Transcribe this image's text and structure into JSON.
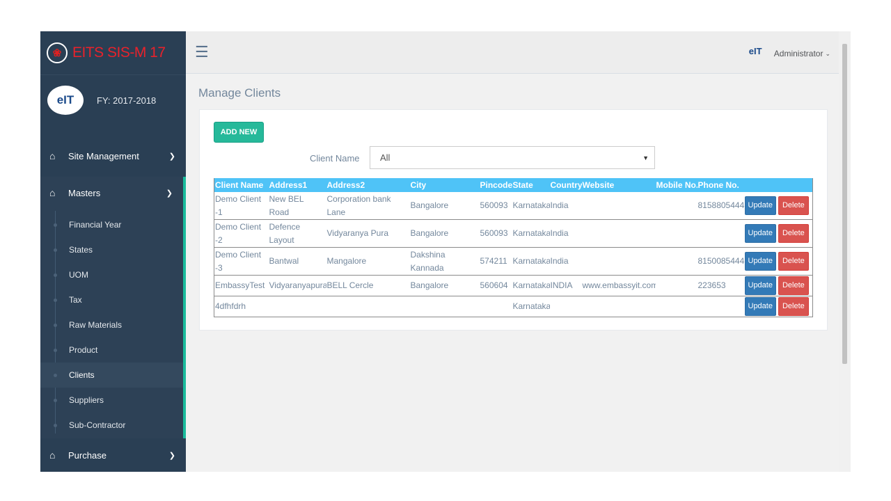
{
  "brand": {
    "logo_glyph": "❀",
    "title": "EITS SIS-M 17"
  },
  "profile": {
    "avatar_text": "eIT",
    "fy": "FY: 2017-2018"
  },
  "nav": {
    "site_management": "Site Management",
    "masters": "Masters",
    "purchase": "Purchase",
    "masters_items": [
      "Financial Year",
      "States",
      "UOM",
      "Tax",
      "Raw Materials",
      "Product",
      "Clients",
      "Suppliers",
      "Sub-Contractor"
    ],
    "active_item": "Clients"
  },
  "topbar": {
    "menu_icon": "☰",
    "user": "Administrator",
    "user_logo": "eIT"
  },
  "page": {
    "title": "Manage Clients"
  },
  "toolbar": {
    "add_label": "ADD NEW"
  },
  "filter": {
    "label": "Client Name",
    "selected": "All"
  },
  "table": {
    "headers": [
      "Client Name",
      "Address1",
      "Address2",
      "City",
      "Pincode",
      "State",
      "Country",
      "Website",
      "Mobile No.",
      "Phone No."
    ],
    "update_label": "Update",
    "delete_label": "Delete",
    "rows": [
      [
        "Demo Client -1",
        "New BEL Road",
        "Corporation bank Lane",
        "Bangalore",
        "560093",
        "Karnataka",
        "India",
        "",
        "",
        "8158805444"
      ],
      [
        "Demo Client -2",
        "Defence Layout",
        "Vidyaranya Pura",
        "Bangalore",
        "560093",
        "Karnataka",
        "India",
        "",
        "",
        ""
      ],
      [
        "Demo Client -3",
        "Bantwal",
        "Mangalore",
        "Dakshina Kannada",
        "574211",
        "Karnataka",
        "India",
        "",
        "",
        "8150085444"
      ],
      [
        "EmbassyTest",
        "Vidyaranyapura",
        "BELL Cercle",
        "Bangalore",
        "560604",
        "Karnataka",
        "INDIA",
        "www.embassyit.com",
        "",
        "223653"
      ],
      [
        "4dfhfdrh",
        "",
        "",
        "",
        "",
        "Karnataka",
        "",
        "",
        "",
        ""
      ]
    ]
  },
  "colors": {
    "sidebar": "#2a3f54",
    "brand_red": "#e8222b",
    "accent_green": "#26b99a",
    "table_header": "#4fc3f7",
    "update": "#337ab7",
    "delete": "#d9534f"
  }
}
